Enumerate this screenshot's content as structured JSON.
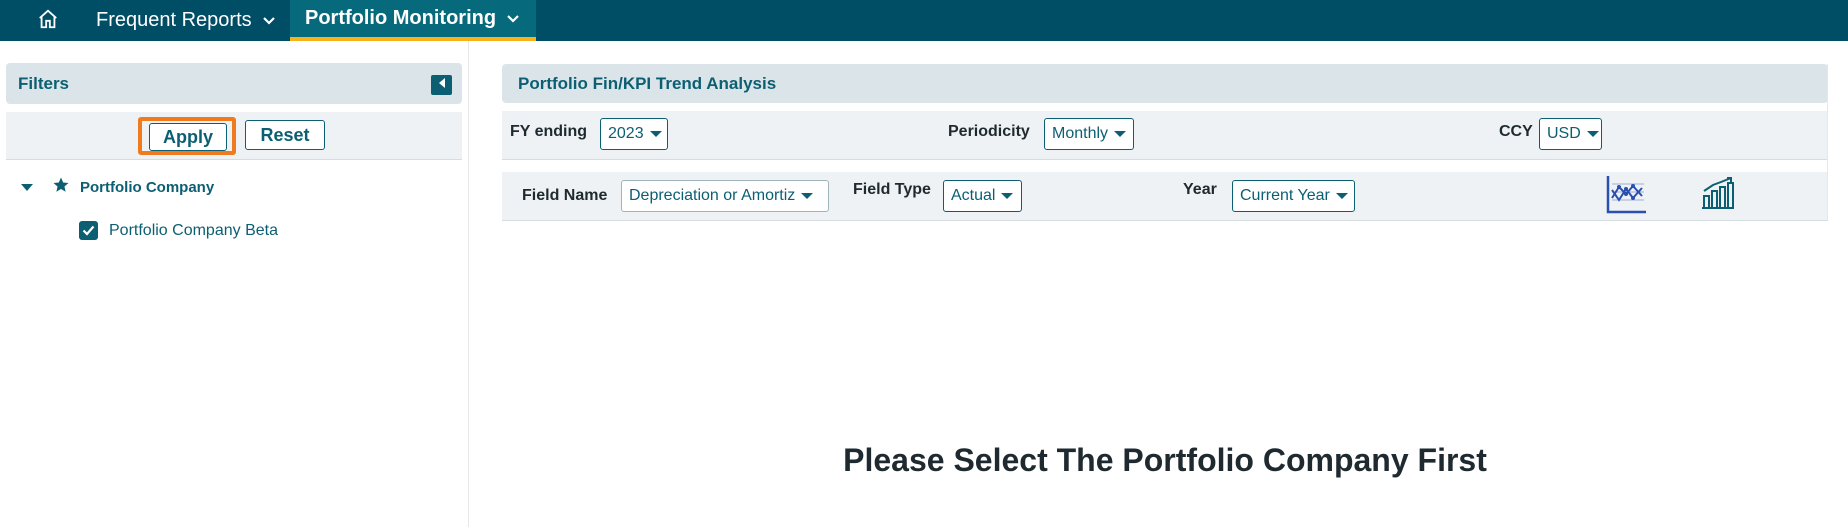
{
  "nav": {
    "home_icon": "home-icon",
    "items": [
      {
        "label": "Frequent Reports"
      },
      {
        "label": "Portfolio Monitoring"
      }
    ],
    "active_color": "#076a7c",
    "active_underline": "#f5b21b"
  },
  "filters": {
    "title": "Filters",
    "apply_label": "Apply",
    "reset_label": "Reset",
    "tree": {
      "parent_label": "Portfolio Company",
      "children": [
        {
          "label": "Portfolio Company Beta",
          "checked": true
        }
      ]
    }
  },
  "main": {
    "title": "Portfolio Fin/KPI Trend Analysis",
    "row1": {
      "fy_label": "FY ending",
      "fy_value": "2023",
      "periodicity_label": "Periodicity",
      "periodicity_value": "Monthly",
      "ccy_label": "CCY",
      "ccy_value": "USD"
    },
    "row2": {
      "field_name_label": "Field Name",
      "field_name_value": "Depreciation or Amortiz",
      "field_type_label": "Field Type",
      "field_type_value": "Actual",
      "year_label": "Year",
      "year_value": "Current Year"
    },
    "empty_message": "Please Select The Portfolio Company First"
  },
  "colors": {
    "topbar": "#004d66",
    "accent": "#0c5f72",
    "focus_outline": "#f07b1e",
    "panel_header": "#dbe5e9",
    "panel_row": "#eef2f4"
  }
}
